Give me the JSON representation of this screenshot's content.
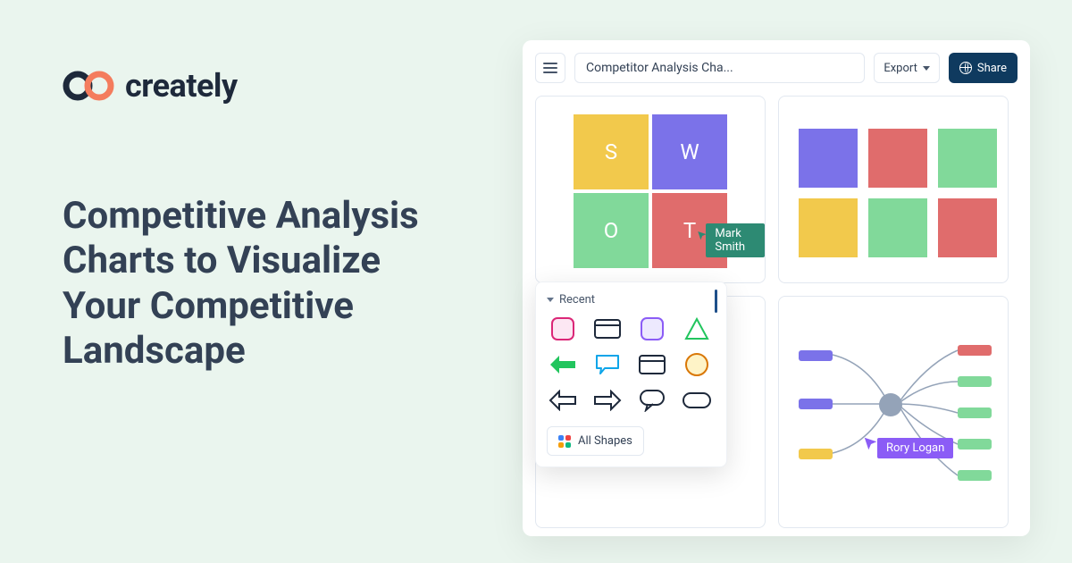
{
  "brand": {
    "name": "creately"
  },
  "headline": "Competitive Analysis Charts to Visualize Your Competitive Landscape",
  "toolbar": {
    "doc_title": "Competitor Analysis Cha...",
    "export_label": "Export",
    "share_label": "Share"
  },
  "swot": {
    "s": "S",
    "w": "W",
    "o": "O",
    "t": "T"
  },
  "cursors": {
    "mark": "Mark Smith",
    "rory": "Rory Logan"
  },
  "shapes_panel": {
    "section": "Recent",
    "all_shapes": "All Shapes"
  },
  "colors": {
    "yellow": "#f2c94c",
    "purple": "#7b72e9",
    "green": "#81d99a",
    "red": "#e06c6c"
  }
}
